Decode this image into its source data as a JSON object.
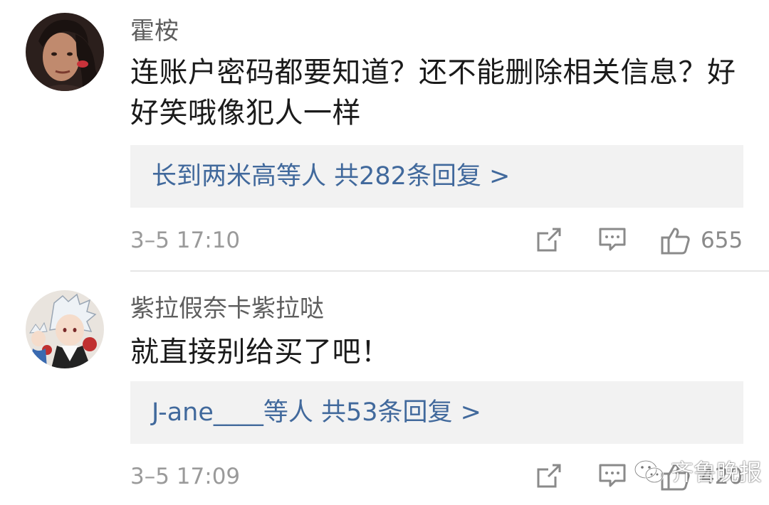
{
  "comments": [
    {
      "username": "霍桉",
      "content": "连账户密码都要知道？还不能删除相关信息？好好笑哦像犯人一样",
      "replies_text": "长到两米高等人 共282条回复 >",
      "time": "3–5 17:10",
      "likes": "655",
      "avatar_icon": "user-avatar-photo"
    },
    {
      "username": "紫拉假奈卡紫拉哒",
      "content": "就直接别给买了吧！",
      "replies_text": "J-ane____等人 共53条回复 >",
      "time": "3–5 17:09",
      "likes": "420",
      "avatar_icon": "user-avatar-anime"
    }
  ],
  "watermark": {
    "text": "齐鲁晚报",
    "icon": "wechat-icon"
  },
  "colors": {
    "reply_link": "#41699c",
    "reply_background": "#f2f2f2",
    "username": "#5e5e5e",
    "meta_text": "#9a9a9a",
    "icon_stroke": "#8a8a8a"
  }
}
